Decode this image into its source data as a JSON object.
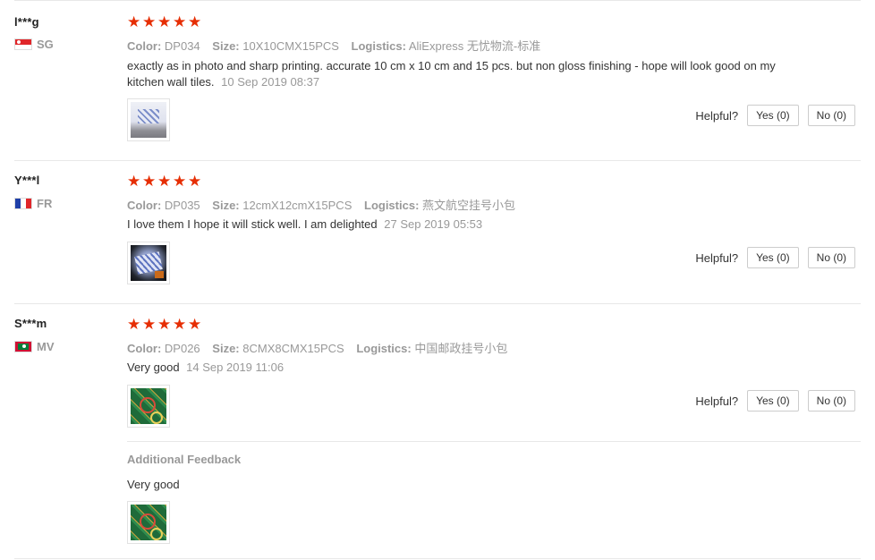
{
  "helpful_label": "Helpful?",
  "reviews": [
    {
      "user": "l***g",
      "country": "SG",
      "color_label": "Color:",
      "color": "DP034",
      "size_label": "Size:",
      "size": "10X10CMX15PCS",
      "logistics_label": "Logistics:",
      "logistics": "AliExpress 无忧物流-标准",
      "text": "exactly as in photo and sharp printing. accurate 10 cm x 10 cm and 15 pcs. but non gloss finishing - hope will look good on my kitchen wall tiles.",
      "date": "10 Sep 2019 08:37",
      "stars": 5,
      "yes": "Yes (0)",
      "no": "No (0)"
    },
    {
      "user": "Y***l",
      "country": "FR",
      "color_label": "Color:",
      "color": "DP035",
      "size_label": "Size:",
      "size": "12cmX12cmX15PCS",
      "logistics_label": "Logistics:",
      "logistics": "燕文航空挂号小包",
      "text": "I love them I hope it will stick well. I am delighted",
      "date": "27 Sep 2019 05:53",
      "stars": 5,
      "yes": "Yes (0)",
      "no": "No (0)"
    },
    {
      "user": "S***m",
      "country": "MV",
      "color_label": "Color:",
      "color": "DP026",
      "size_label": "Size:",
      "size": "8CMX8CMX15PCS",
      "logistics_label": "Logistics:",
      "logistics": "中国邮政挂号小包",
      "text": "Very good",
      "date": "14 Sep 2019 11:06",
      "stars": 5,
      "yes": "Yes (0)",
      "no": "No (0)",
      "additional_title": "Additional Feedback",
      "additional_text": "Very good"
    }
  ],
  "colors": {
    "star": "#e62e04",
    "muted": "#999999"
  }
}
